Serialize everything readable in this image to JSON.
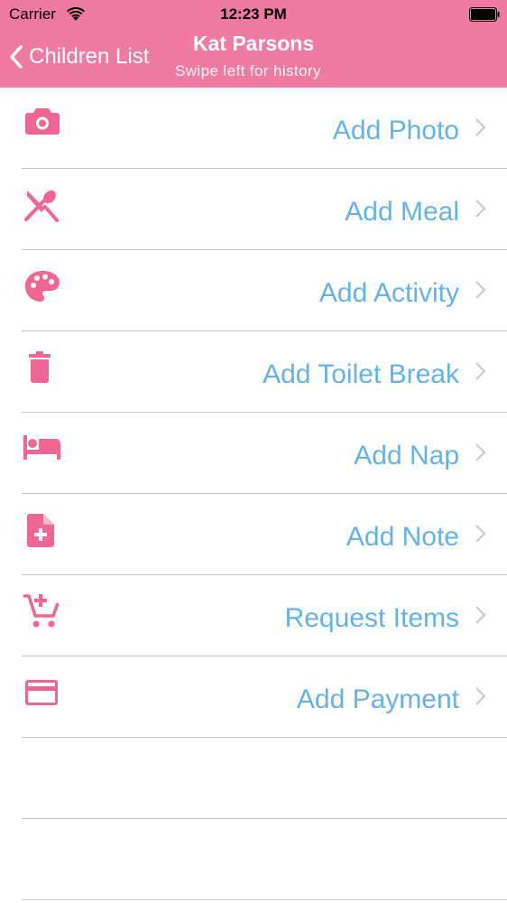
{
  "status_bar": {
    "carrier": "Carrier",
    "time": "12:23 PM"
  },
  "nav": {
    "back_label": "Children List",
    "title": "Kat Parsons",
    "subtitle": "Swipe left for history"
  },
  "menu": {
    "items": [
      {
        "label": "Add Photo",
        "icon": "camera-icon"
      },
      {
        "label": "Add Meal",
        "icon": "utensils-icon"
      },
      {
        "label": "Add Activity",
        "icon": "palette-icon"
      },
      {
        "label": "Add Toilet Break",
        "icon": "trash-can-icon"
      },
      {
        "label": "Add Nap",
        "icon": "bed-icon"
      },
      {
        "label": "Add Note",
        "icon": "note-add-icon"
      },
      {
        "label": "Request Items",
        "icon": "cart-add-icon"
      },
      {
        "label": "Add Payment",
        "icon": "credit-card-icon"
      }
    ]
  },
  "colors": {
    "header_bg": "#F17AA2",
    "icon": "#F06692",
    "label": "#64B2E8",
    "separator": "#C8C7CC"
  }
}
